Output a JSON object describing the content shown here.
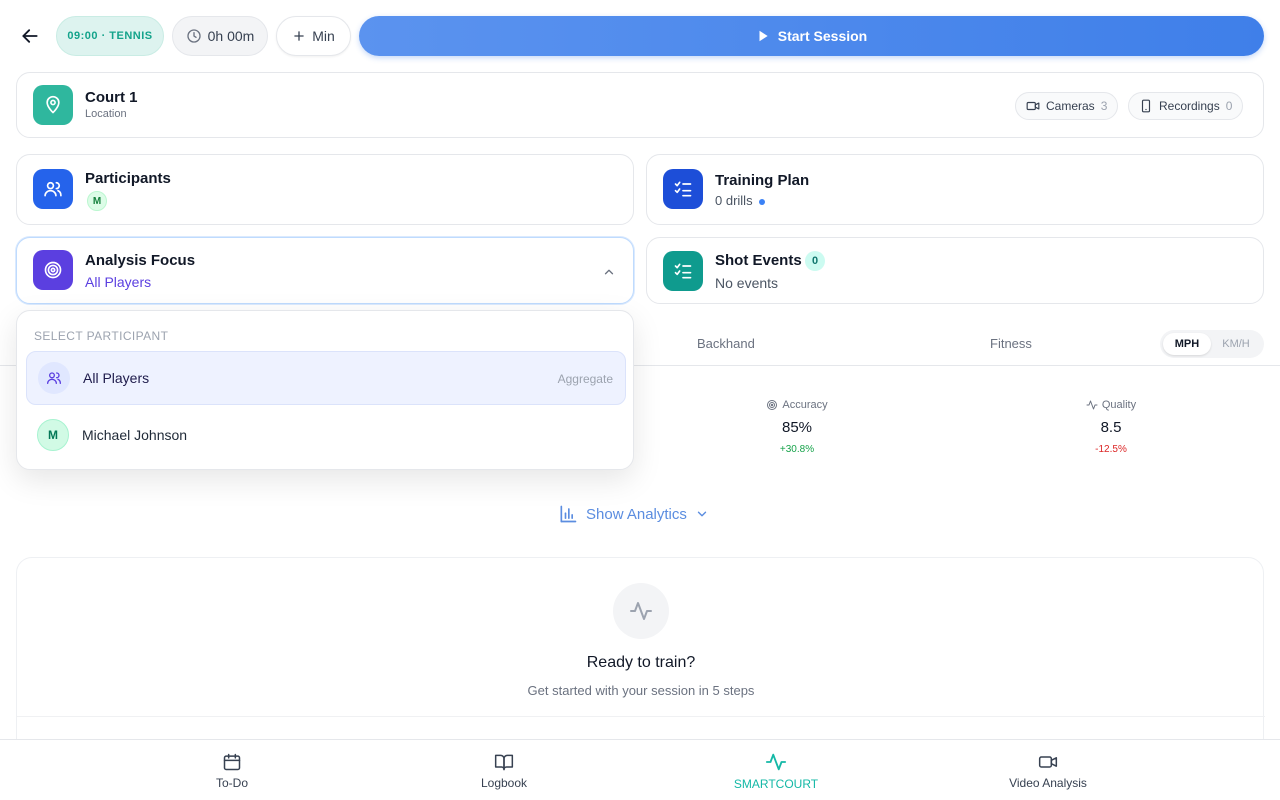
{
  "header": {
    "sport_pill": "09:00 · TENNIS",
    "timer": "0h 00m",
    "add_min": "Min",
    "start_label": "Start Session"
  },
  "court": {
    "title": "Court 1",
    "subtitle": "Location",
    "cameras_label": "Cameras",
    "cameras_count": "3",
    "recordings_label": "Recordings",
    "recordings_count": "0"
  },
  "participants": {
    "title": "Participants",
    "initial": "M"
  },
  "training_plan": {
    "title": "Training Plan",
    "subtitle": "0 drills"
  },
  "analysis_focus": {
    "title": "Analysis Focus",
    "value": "All Players"
  },
  "shot_events": {
    "title": "Shot Events",
    "count": "0",
    "subtitle": "No events"
  },
  "tabs": {
    "backhand": "Backhand",
    "fitness": "Fitness"
  },
  "units": {
    "active": "MPH",
    "inactive": "KM/H"
  },
  "metrics": {
    "accuracy": {
      "label": "Accuracy",
      "value": "85%",
      "delta": "+30.8%"
    },
    "quality": {
      "label": "Quality",
      "value": "8.5",
      "delta": "-12.5%"
    }
  },
  "analytics": {
    "toggle_label": "Show Analytics"
  },
  "ready": {
    "title": "Ready to train?",
    "subtitle": "Get started with your session in 5 steps"
  },
  "dropdown": {
    "header": "SELECT PARTICIPANT",
    "options": [
      {
        "name": "All Players",
        "tag": "Aggregate"
      },
      {
        "initial": "M",
        "name": "Michael Johnson"
      }
    ]
  },
  "bottom_nav": [
    {
      "label": "To-Do"
    },
    {
      "label": "Logbook"
    },
    {
      "label": "SMARTCOURT"
    },
    {
      "label": "Video Analysis"
    }
  ],
  "colors": {
    "accent_blue": "#3f7fe9",
    "teal": "#14b8a6",
    "purple": "#5b3fe0",
    "positive": "#16a34a",
    "negative": "#dc2626"
  }
}
